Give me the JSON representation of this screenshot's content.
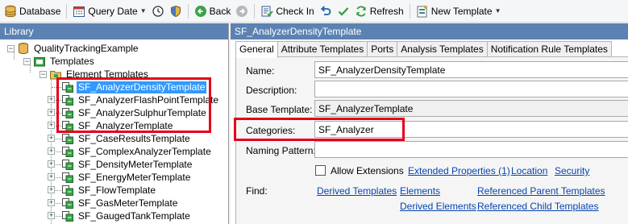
{
  "toolbar": {
    "database": "Database",
    "query_date": "Query Date",
    "back": "Back",
    "check_in": "Check In",
    "refresh": "Refresh",
    "new_template": "New Template"
  },
  "library": {
    "title": "Library",
    "root": "QualityTrackingExample",
    "templates": "Templates",
    "element_templates": "Element Templates",
    "items": [
      "SF_AnalyzerDensityTemplate",
      "SF_AnalyzerFlashPointTemplate",
      "SF_AnalyzerSulphurTemplate",
      "SF_AnalyzerTemplate",
      "SF_CaseResultsTemplate",
      "SF_ComplexAnalyzerTemplate",
      "SF_DensityMeterTemplate",
      "SF_EnergyMeterTemplate",
      "SF_FlowTemplate",
      "SF_GasMeterTemplate",
      "SF_GaugedTankTemplate"
    ]
  },
  "detail": {
    "title": "SF_AnalyzerDensityTemplate",
    "tabs": [
      "General",
      "Attribute Templates",
      "Ports",
      "Analysis Templates",
      "Notification Rule Templates"
    ],
    "labels": {
      "name": "Name:",
      "description": "Description:",
      "base_template": "Base Template:",
      "categories": "Categories:",
      "naming_pattern": "Naming Pattern:",
      "find": "Find:"
    },
    "values": {
      "name": "SF_AnalyzerDensityTemplate",
      "description": "",
      "base_template": "SF_AnalyzerTemplate",
      "categories": "SF_Analyzer",
      "naming_pattern": ""
    },
    "allow_extensions": "Allow Extensions",
    "allow_extensions_checked": false,
    "links": {
      "extended_properties": "Extended Properties (1)",
      "location": "Location",
      "security": "Security",
      "derived_templates": "Derived Templates",
      "elements": "Elements",
      "referenced_parent_templates": "Referenced Parent Templates",
      "derived_elements": "Derived Elements",
      "referenced_child_templates": "Referenced Child Templates"
    }
  },
  "colors": {
    "pane_header": "#5b82b2",
    "selection": "#3399ff",
    "highlight_box": "#e3001b",
    "link": "#0645ad"
  }
}
